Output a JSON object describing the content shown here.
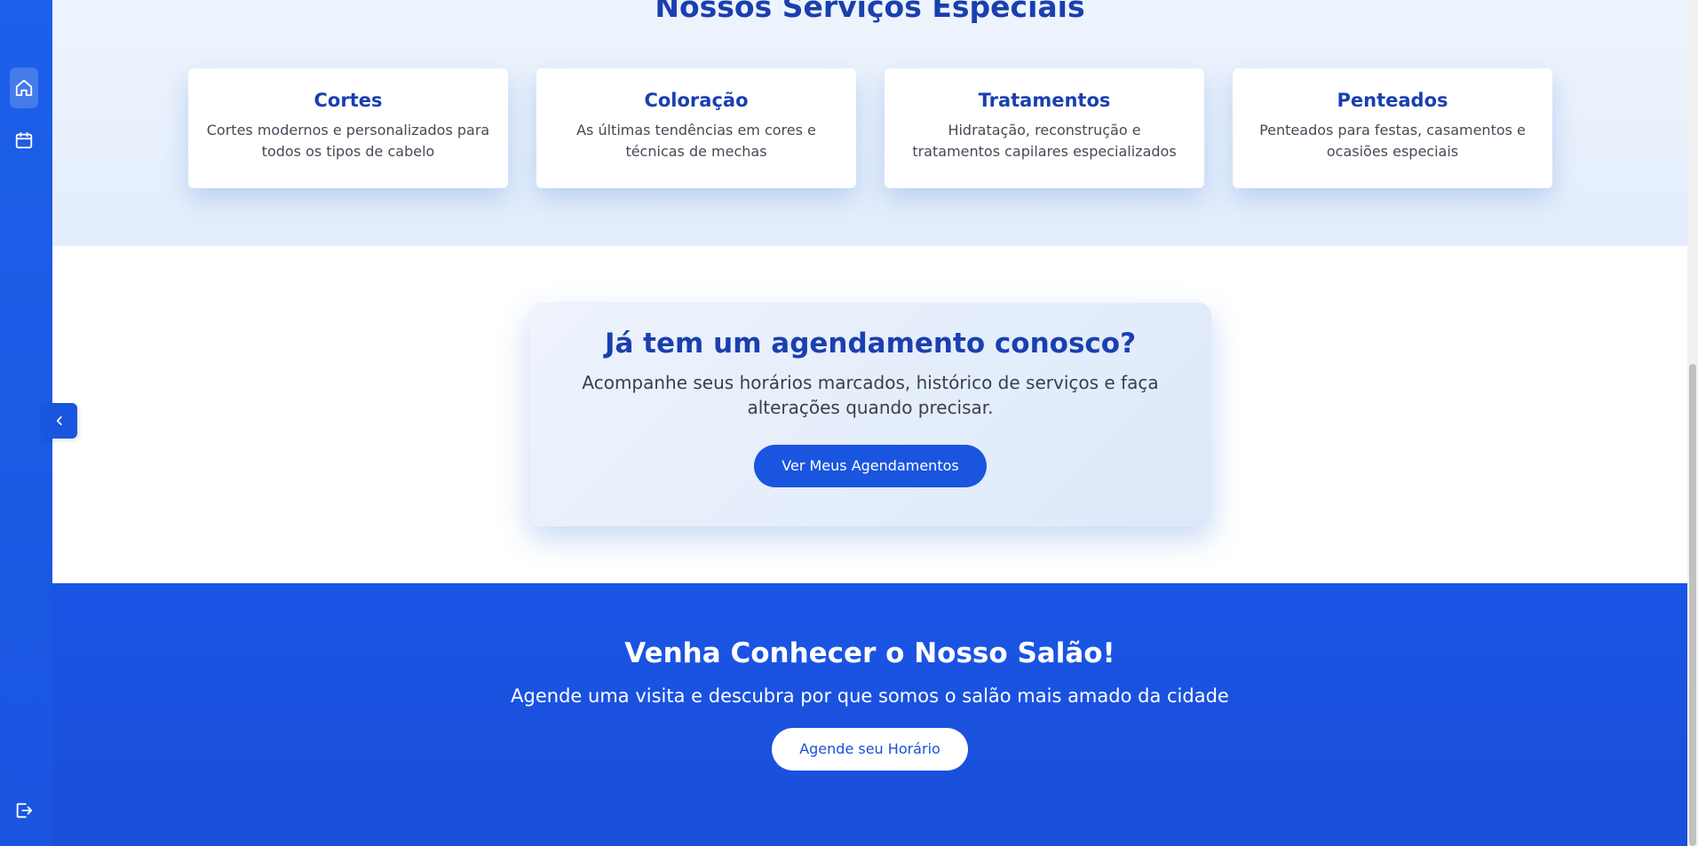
{
  "sidebar": {
    "items": [
      {
        "icon": "home-icon",
        "active": true
      },
      {
        "icon": "calendar-icon",
        "active": false
      }
    ],
    "logout_icon": "logout-icon",
    "collapse_icon": "chevron-left-icon"
  },
  "services": {
    "title": "Nossos Serviços Especiais",
    "cards": [
      {
        "title": "Cortes",
        "description": "Cortes modernos e personalizados para todos os tipos de cabelo"
      },
      {
        "title": "Coloração",
        "description": "As últimas tendências em cores e técnicas de mechas"
      },
      {
        "title": "Tratamentos",
        "description": "Hidratação, reconstrução e tratamentos capilares especializados"
      },
      {
        "title": "Penteados",
        "description": "Penteados para festas, casamentos e ocasiões especiais"
      }
    ]
  },
  "appointment_cta": {
    "title": "Já tem um agendamento conosco?",
    "text": "Acompanhe seus horários marcados, histórico de serviços e faça alterações quando precisar.",
    "button_label": "Ver Meus Agendamentos"
  },
  "visit": {
    "title": "Venha Conhecer o Nosso Salão!",
    "text": "Agende uma visita e descubra por que somos o salão mais amado da cidade",
    "button_label": "Agende seu Horário"
  },
  "colors": {
    "primary": "#1a55e0",
    "heading": "#1a3fb0",
    "section_bg": "#e8f0fc"
  }
}
